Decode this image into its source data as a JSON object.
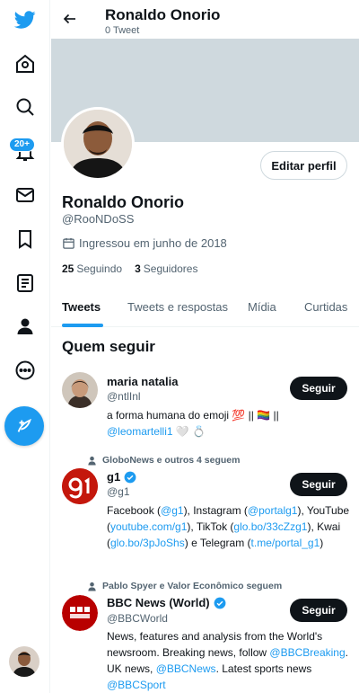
{
  "rail": {
    "notifications_badge": "20+"
  },
  "header": {
    "name": "Ronaldo Onorio",
    "tweet_count": "0 Tweet"
  },
  "profile": {
    "edit_label": "Editar perfil",
    "name": "Ronaldo Onorio",
    "handle": "@RooNDoSS",
    "joined": "Ingressou em junho de 2018",
    "following_count": "25",
    "following_label": "Seguindo",
    "followers_count": "3",
    "followers_label": "Seguidores"
  },
  "tabs": [
    {
      "label": "Tweets",
      "active": true
    },
    {
      "label": "Tweets e respostas",
      "active": false
    },
    {
      "label": "Mídia",
      "active": false
    },
    {
      "label": "Curtidas",
      "active": false
    }
  ],
  "who_to_follow": {
    "title": "Quem seguir",
    "follow_label": "Seguir",
    "accounts": [
      {
        "name": "maria natalia",
        "handle": "@ntlInl",
        "bio_text": "a forma humana do emoji 💯 || 🏳️‍🌈 ||",
        "bio_link": "@leomartelli1",
        "bio_suffix": " 🤍 💍"
      },
      {
        "social_context": "GloboNews e outros 4 seguem",
        "name": "g1",
        "handle": "@g1",
        "bio": [
          {
            "t": "Facebook (",
            "link": false
          },
          {
            "t": "@g1",
            "link": true
          },
          {
            "t": "), Instagram (",
            "link": false
          },
          {
            "t": "@portalg1",
            "link": true
          },
          {
            "t": "), YouTube (",
            "link": false
          },
          {
            "t": "youtube.com/g1",
            "link": true
          },
          {
            "t": "), TikTok (",
            "link": false
          },
          {
            "t": "glo.bo/33cZzg1",
            "link": true
          },
          {
            "t": "), Kwai (",
            "link": false
          },
          {
            "t": "glo.bo/3pJoShs",
            "link": true
          },
          {
            "t": ") e Telegram (",
            "link": false
          },
          {
            "t": "t.me/portal_g1",
            "link": true
          },
          {
            "t": ")",
            "link": false
          }
        ]
      },
      {
        "social_context": "Pablo Spyer e Valor Econômico seguem",
        "name": "BBC News (World)",
        "handle": "@BBCWorld",
        "bio": [
          {
            "t": "News, features and analysis from the World's newsroom. Breaking news, follow ",
            "link": false
          },
          {
            "t": "@BBCBreaking",
            "link": true
          },
          {
            "t": ". UK news, ",
            "link": false
          },
          {
            "t": "@BBCNews",
            "link": true
          },
          {
            "t": ". Latest sports news ",
            "link": false
          },
          {
            "t": "@BBCSport",
            "link": true
          }
        ]
      }
    ]
  },
  "colors": {
    "accent": "#1d9bf0",
    "banner": "#cfd9de",
    "g1_red": "#c4170c",
    "bbc_red": "#b80000"
  },
  "icons": [
    "twitter-logo-icon",
    "home-icon",
    "explore-icon",
    "notifications-icon",
    "messages-icon",
    "bookmarks-icon",
    "lists-icon",
    "profile-icon",
    "more-icon",
    "compose-icon",
    "back-arrow-icon",
    "calendar-icon",
    "verified-icon",
    "person-icon"
  ]
}
